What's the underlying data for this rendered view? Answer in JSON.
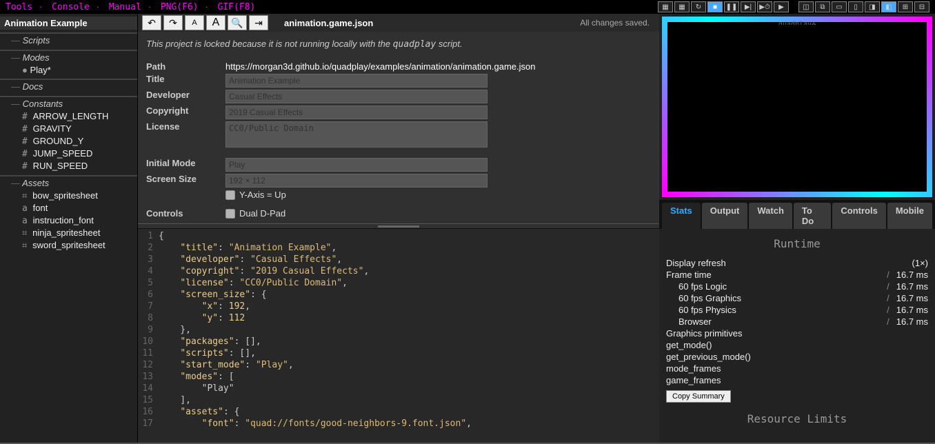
{
  "topmenu": {
    "tools": "Tools",
    "console": "Console",
    "manual": "Manual",
    "png": "PNG(F6)",
    "gif": "GIF(F8)"
  },
  "project": {
    "title": "Animation Example"
  },
  "tree": {
    "scripts": "Scripts",
    "modes": "Modes",
    "mode_items": [
      "Play*"
    ],
    "docs": "Docs",
    "constants": "Constants",
    "const_items": [
      "ARROW_LENGTH",
      "GRAVITY",
      "GROUND_Y",
      "JUMP_SPEED",
      "RUN_SPEED"
    ],
    "assets": "Assets",
    "asset_items": [
      "bow_spritesheet",
      "font",
      "instruction_font",
      "ninja_spritesheet",
      "sword_spritesheet"
    ]
  },
  "toolbar": {
    "filename": "animation.game.json",
    "saved": "All changes saved."
  },
  "locked_msg_a": "This project is locked because it is not running locally with the ",
  "locked_msg_b": "quadplay",
  "locked_msg_c": " script.",
  "form": {
    "path_label": "Path",
    "path": "https://morgan3d.github.io/quadplay/examples/animation/animation.game.json",
    "title_label": "Title",
    "title": "Animation Example",
    "dev_label": "Developer",
    "dev": "Casual Effects",
    "copy_label": "Copyright",
    "copy": "2019 Casual Effects",
    "lic_label": "License",
    "lic": "CC0/Public Domain",
    "mode_label": "Initial Mode",
    "mode": "Play",
    "size_label": "Screen Size",
    "size": "192 × 112",
    "yaxis": "Y-Axis = Up",
    "controls_label": "Controls",
    "dpad": "Dual D-Pad"
  },
  "code_lines": [
    "{",
    "    \"title\": \"Animation Example\",",
    "    \"developer\": \"Casual Effects\",",
    "    \"copyright\": \"2019 Casual Effects\",",
    "    \"license\": \"CC0/Public Domain\",",
    "    \"screen_size\": {",
    "        \"x\": 192,",
    "        \"y\": 112",
    "    },",
    "    \"packages\": [],",
    "    \"scripts\": [],",
    "    \"start_mode\": \"Play\",",
    "    \"modes\": [",
    "        \"Play\"",
    "    ],",
    "    \"assets\": {",
    "        \"font\": \"quad://fonts/good-neighbors-9.font.json\","
  ],
  "preview": {
    "label": "quadplay✜"
  },
  "tabs": {
    "stats": "Stats",
    "output": "Output",
    "watch": "Watch",
    "todo": "To Do",
    "controls": "Controls",
    "mobile": "Mobile"
  },
  "stats": {
    "runtime": "Runtime",
    "refresh": "Display refresh",
    "refresh_v": "(1×)",
    "frame": "Frame time",
    "frame_s": "/",
    "frame_v": "16.7 ms",
    "logic": "60 fps Logic",
    "logic_s": "/",
    "logic_v": "16.7 ms",
    "gfx": "60 fps Graphics",
    "gfx_s": "/",
    "gfx_v": "16.7 ms",
    "phys": "60 fps Physics",
    "phys_s": "/",
    "phys_v": "16.7 ms",
    "browser": "Browser",
    "browser_s": "/",
    "browser_v": "16.7 ms",
    "prim": "Graphics primitives",
    "getmode": "get_mode()",
    "getprev": "get_previous_mode()",
    "mframes": "mode_frames",
    "gframes": "game_frames",
    "copy": "Copy Summary",
    "limits": "Resource Limits"
  }
}
